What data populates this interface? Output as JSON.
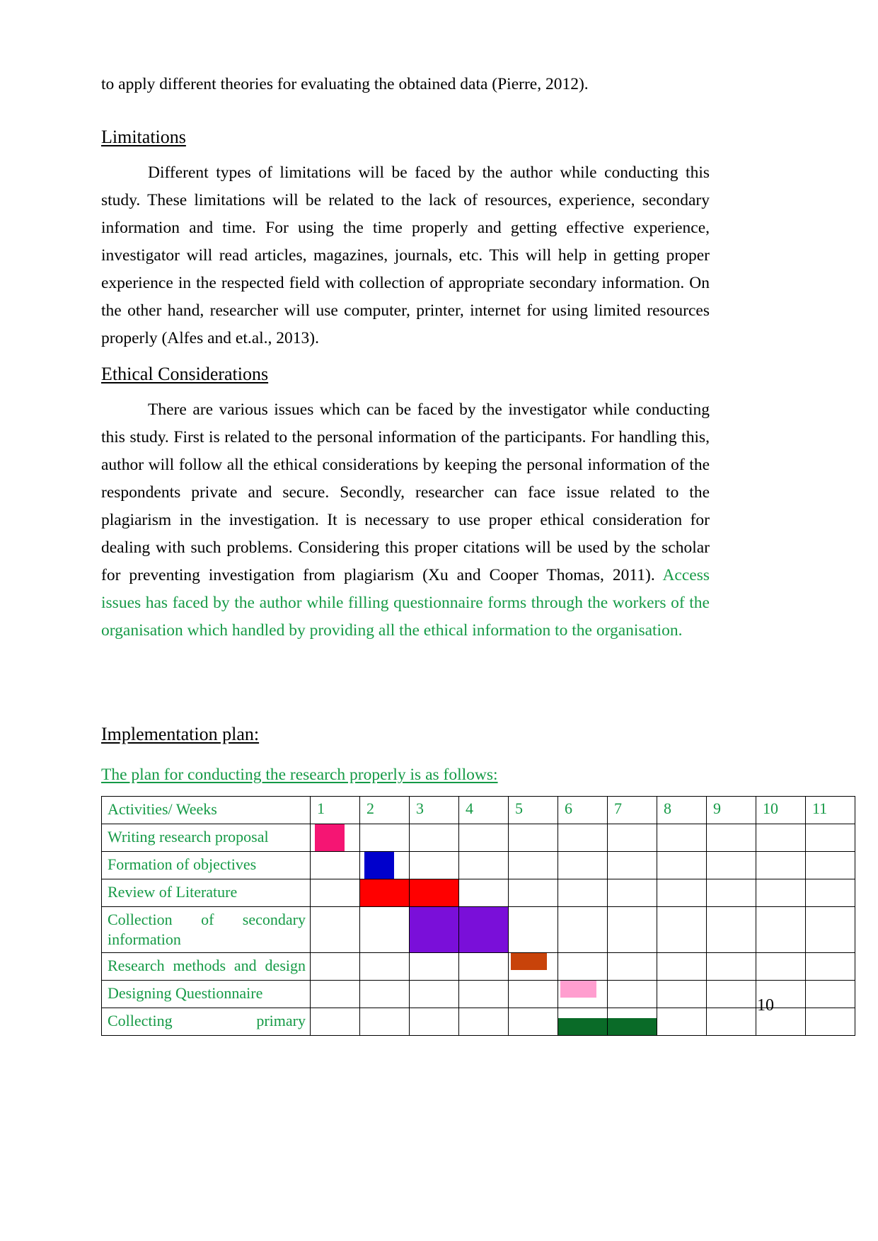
{
  "document": {
    "page_number": "10",
    "top_paragraph": "to apply different theories for evaluating the obtained data (Pierre, 2012).",
    "sections": [
      {
        "heading": "Limitations",
        "paragraph": "Different types of limitations will be faced by the author while conducting this study. These limitations will be related to the lack of resources, experience, secondary information and time. For using the time properly and getting effective experience, investigator will read articles, magazines, journals, etc. This will help in getting proper experience in the respected field with collection of appropriate secondary information. On the other hand, researcher will use computer, printer, internet for using limited resources properly (Alfes and et.al., 2013)."
      },
      {
        "heading": "Ethical Considerations",
        "paragraph_black": "There are various issues which can be faced by the investigator while conducting this study. First is related to the personal information of the participants. For handling this, author will follow all the ethical considerations by keeping the personal information of the respondents private and secure. Secondly, researcher can face issue related to the plagiarism in the investigation. It is necessary to use proper ethical consideration for dealing with such problems. Considering this proper citations will be used by the scholar for preventing investigation from plagiarism (Xu and Cooper Thomas, 2011).",
        "paragraph_green": " Access issues has faced by the author while filling questionnaire forms through the workers of the organisation which handled by providing all the ethical information to the organisation."
      }
    ],
    "implementation": {
      "heading": "Implementation plan: ",
      "subtitle": "The plan for conducting the research properly is as follows: "
    }
  },
  "colors": {
    "green_text": "#159A46",
    "pink": "#F51573",
    "blue": "#0000CC",
    "red": "#FF0000",
    "purple": "#7A0FD9",
    "orange": "#C8430A",
    "light_pink": "#FF9ECF",
    "dark_green": "#0A6B28"
  },
  "table": {
    "header": {
      "activity_label": "Activities/ Weeks",
      "weeks": [
        "1",
        "2",
        "3",
        "4",
        "5",
        "6",
        "7",
        "8",
        "9",
        "10",
        "11"
      ]
    },
    "rows": [
      {
        "activity": "Writing research proposal",
        "justify": false,
        "bars": [
          {
            "week": 1,
            "color": "#F51573",
            "style": "narrow"
          }
        ]
      },
      {
        "activity": "Formation of objectives",
        "justify": false,
        "bars": [
          {
            "week": 2,
            "color": "#0000CC",
            "style": "narrow"
          }
        ]
      },
      {
        "activity": "Review of Literature",
        "justify": false,
        "bars": [
          {
            "week": 2,
            "color": "#FF0000",
            "style": "full"
          },
          {
            "week": 3,
            "color": "#FF0000",
            "style": "full"
          }
        ]
      },
      {
        "activity": "Collection of secondary information",
        "justify": true,
        "bars": [
          {
            "week": 3,
            "color": "#7A0FD9",
            "style": "full"
          },
          {
            "week": 4,
            "color": "#7A0FD9",
            "style": "full"
          }
        ]
      },
      {
        "activity": "Research methods and design",
        "justify": true,
        "bars": [
          {
            "week": 5,
            "color": "#C8430A",
            "style": "narrow-half"
          }
        ]
      },
      {
        "activity": "Designing Questionnaire",
        "justify": false,
        "bars": [
          {
            "week": 6,
            "color": "#FF9ECF",
            "style": "narrow-half"
          }
        ]
      },
      {
        "activity": "Collecting primary",
        "justify": true,
        "bars": [
          {
            "week": 6,
            "color": "#0A6B28",
            "style": "halfbot"
          },
          {
            "week": 7,
            "color": "#0A6B28",
            "style": "halfbot"
          }
        ]
      }
    ]
  }
}
